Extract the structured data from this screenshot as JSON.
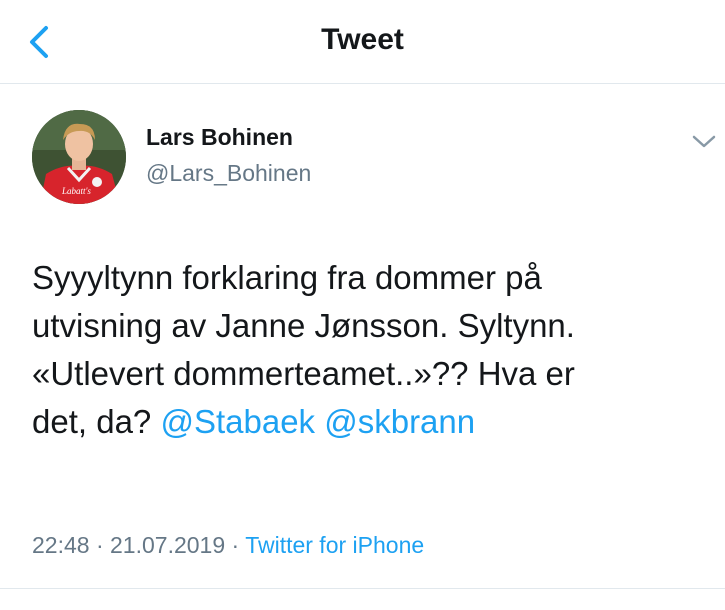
{
  "header": {
    "title": "Tweet"
  },
  "tweet": {
    "author_name": "Lars Bohinen",
    "author_handle": "@Lars_Bohinen",
    "avatar_jersey_text": "Labatt's",
    "text_line1": "Syyyltynn forklaring fra dommer på",
    "text_line2": "utvisning av Janne Jønsson. Syltynn.",
    "text_line3": "«Utlevert dommerteamet..»?? Hva er",
    "text_line4_prefix": "det, da?",
    "mention1": "@Stabaek",
    "mention2": "@skbrann",
    "time": "22:48",
    "date": "21.07.2019",
    "separator": "·",
    "source": "Twitter for iPhone"
  },
  "colors": {
    "accent": "#1da1f2",
    "secondary_text": "#657786",
    "primary_text": "#14171a",
    "divider": "#e1e8ed"
  },
  "icons": {
    "back": "chevron-left-icon",
    "menu": "chevron-down-icon"
  }
}
